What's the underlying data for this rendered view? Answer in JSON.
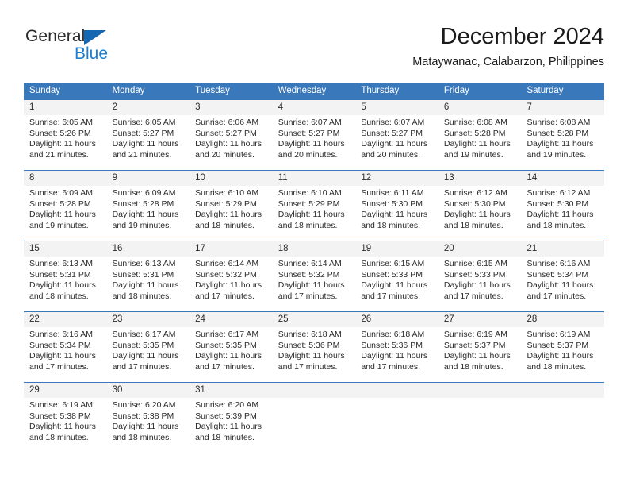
{
  "brand": {
    "name_part1": "General",
    "name_part2": "Blue",
    "triangle_icon": "blue-triangle-icon",
    "accent_color": "#1b7fd4"
  },
  "header": {
    "title": "December 2024",
    "subtitle": "Mataywanac, Calabarzon, Philippines"
  },
  "calendar": {
    "header_bg_color": "#3a78bc",
    "day_band_color": "#f3f3f3",
    "weekdays": [
      "Sunday",
      "Monday",
      "Tuesday",
      "Wednesday",
      "Thursday",
      "Friday",
      "Saturday"
    ],
    "weeks": [
      [
        {
          "day": "1",
          "sunrise": "Sunrise: 6:05 AM",
          "sunset": "Sunset: 5:26 PM",
          "daylight_line1": "Daylight: 11 hours",
          "daylight_line2": "and 21 minutes."
        },
        {
          "day": "2",
          "sunrise": "Sunrise: 6:05 AM",
          "sunset": "Sunset: 5:27 PM",
          "daylight_line1": "Daylight: 11 hours",
          "daylight_line2": "and 21 minutes."
        },
        {
          "day": "3",
          "sunrise": "Sunrise: 6:06 AM",
          "sunset": "Sunset: 5:27 PM",
          "daylight_line1": "Daylight: 11 hours",
          "daylight_line2": "and 20 minutes."
        },
        {
          "day": "4",
          "sunrise": "Sunrise: 6:07 AM",
          "sunset": "Sunset: 5:27 PM",
          "daylight_line1": "Daylight: 11 hours",
          "daylight_line2": "and 20 minutes."
        },
        {
          "day": "5",
          "sunrise": "Sunrise: 6:07 AM",
          "sunset": "Sunset: 5:27 PM",
          "daylight_line1": "Daylight: 11 hours",
          "daylight_line2": "and 20 minutes."
        },
        {
          "day": "6",
          "sunrise": "Sunrise: 6:08 AM",
          "sunset": "Sunset: 5:28 PM",
          "daylight_line1": "Daylight: 11 hours",
          "daylight_line2": "and 19 minutes."
        },
        {
          "day": "7",
          "sunrise": "Sunrise: 6:08 AM",
          "sunset": "Sunset: 5:28 PM",
          "daylight_line1": "Daylight: 11 hours",
          "daylight_line2": "and 19 minutes."
        }
      ],
      [
        {
          "day": "8",
          "sunrise": "Sunrise: 6:09 AM",
          "sunset": "Sunset: 5:28 PM",
          "daylight_line1": "Daylight: 11 hours",
          "daylight_line2": "and 19 minutes."
        },
        {
          "day": "9",
          "sunrise": "Sunrise: 6:09 AM",
          "sunset": "Sunset: 5:28 PM",
          "daylight_line1": "Daylight: 11 hours",
          "daylight_line2": "and 19 minutes."
        },
        {
          "day": "10",
          "sunrise": "Sunrise: 6:10 AM",
          "sunset": "Sunset: 5:29 PM",
          "daylight_line1": "Daylight: 11 hours",
          "daylight_line2": "and 18 minutes."
        },
        {
          "day": "11",
          "sunrise": "Sunrise: 6:10 AM",
          "sunset": "Sunset: 5:29 PM",
          "daylight_line1": "Daylight: 11 hours",
          "daylight_line2": "and 18 minutes."
        },
        {
          "day": "12",
          "sunrise": "Sunrise: 6:11 AM",
          "sunset": "Sunset: 5:30 PM",
          "daylight_line1": "Daylight: 11 hours",
          "daylight_line2": "and 18 minutes."
        },
        {
          "day": "13",
          "sunrise": "Sunrise: 6:12 AM",
          "sunset": "Sunset: 5:30 PM",
          "daylight_line1": "Daylight: 11 hours",
          "daylight_line2": "and 18 minutes."
        },
        {
          "day": "14",
          "sunrise": "Sunrise: 6:12 AM",
          "sunset": "Sunset: 5:30 PM",
          "daylight_line1": "Daylight: 11 hours",
          "daylight_line2": "and 18 minutes."
        }
      ],
      [
        {
          "day": "15",
          "sunrise": "Sunrise: 6:13 AM",
          "sunset": "Sunset: 5:31 PM",
          "daylight_line1": "Daylight: 11 hours",
          "daylight_line2": "and 18 minutes."
        },
        {
          "day": "16",
          "sunrise": "Sunrise: 6:13 AM",
          "sunset": "Sunset: 5:31 PM",
          "daylight_line1": "Daylight: 11 hours",
          "daylight_line2": "and 18 minutes."
        },
        {
          "day": "17",
          "sunrise": "Sunrise: 6:14 AM",
          "sunset": "Sunset: 5:32 PM",
          "daylight_line1": "Daylight: 11 hours",
          "daylight_line2": "and 17 minutes."
        },
        {
          "day": "18",
          "sunrise": "Sunrise: 6:14 AM",
          "sunset": "Sunset: 5:32 PM",
          "daylight_line1": "Daylight: 11 hours",
          "daylight_line2": "and 17 minutes."
        },
        {
          "day": "19",
          "sunrise": "Sunrise: 6:15 AM",
          "sunset": "Sunset: 5:33 PM",
          "daylight_line1": "Daylight: 11 hours",
          "daylight_line2": "and 17 minutes."
        },
        {
          "day": "20",
          "sunrise": "Sunrise: 6:15 AM",
          "sunset": "Sunset: 5:33 PM",
          "daylight_line1": "Daylight: 11 hours",
          "daylight_line2": "and 17 minutes."
        },
        {
          "day": "21",
          "sunrise": "Sunrise: 6:16 AM",
          "sunset": "Sunset: 5:34 PM",
          "daylight_line1": "Daylight: 11 hours",
          "daylight_line2": "and 17 minutes."
        }
      ],
      [
        {
          "day": "22",
          "sunrise": "Sunrise: 6:16 AM",
          "sunset": "Sunset: 5:34 PM",
          "daylight_line1": "Daylight: 11 hours",
          "daylight_line2": "and 17 minutes."
        },
        {
          "day": "23",
          "sunrise": "Sunrise: 6:17 AM",
          "sunset": "Sunset: 5:35 PM",
          "daylight_line1": "Daylight: 11 hours",
          "daylight_line2": "and 17 minutes."
        },
        {
          "day": "24",
          "sunrise": "Sunrise: 6:17 AM",
          "sunset": "Sunset: 5:35 PM",
          "daylight_line1": "Daylight: 11 hours",
          "daylight_line2": "and 17 minutes."
        },
        {
          "day": "25",
          "sunrise": "Sunrise: 6:18 AM",
          "sunset": "Sunset: 5:36 PM",
          "daylight_line1": "Daylight: 11 hours",
          "daylight_line2": "and 17 minutes."
        },
        {
          "day": "26",
          "sunrise": "Sunrise: 6:18 AM",
          "sunset": "Sunset: 5:36 PM",
          "daylight_line1": "Daylight: 11 hours",
          "daylight_line2": "and 17 minutes."
        },
        {
          "day": "27",
          "sunrise": "Sunrise: 6:19 AM",
          "sunset": "Sunset: 5:37 PM",
          "daylight_line1": "Daylight: 11 hours",
          "daylight_line2": "and 18 minutes."
        },
        {
          "day": "28",
          "sunrise": "Sunrise: 6:19 AM",
          "sunset": "Sunset: 5:37 PM",
          "daylight_line1": "Daylight: 11 hours",
          "daylight_line2": "and 18 minutes."
        }
      ],
      [
        {
          "day": "29",
          "sunrise": "Sunrise: 6:19 AM",
          "sunset": "Sunset: 5:38 PM",
          "daylight_line1": "Daylight: 11 hours",
          "daylight_line2": "and 18 minutes."
        },
        {
          "day": "30",
          "sunrise": "Sunrise: 6:20 AM",
          "sunset": "Sunset: 5:38 PM",
          "daylight_line1": "Daylight: 11 hours",
          "daylight_line2": "and 18 minutes."
        },
        {
          "day": "31",
          "sunrise": "Sunrise: 6:20 AM",
          "sunset": "Sunset: 5:39 PM",
          "daylight_line1": "Daylight: 11 hours",
          "daylight_line2": "and 18 minutes."
        },
        {
          "day": "",
          "sunrise": "",
          "sunset": "",
          "daylight_line1": "",
          "daylight_line2": ""
        },
        {
          "day": "",
          "sunrise": "",
          "sunset": "",
          "daylight_line1": "",
          "daylight_line2": ""
        },
        {
          "day": "",
          "sunrise": "",
          "sunset": "",
          "daylight_line1": "",
          "daylight_line2": ""
        },
        {
          "day": "",
          "sunrise": "",
          "sunset": "",
          "daylight_line1": "",
          "daylight_line2": ""
        }
      ]
    ]
  }
}
